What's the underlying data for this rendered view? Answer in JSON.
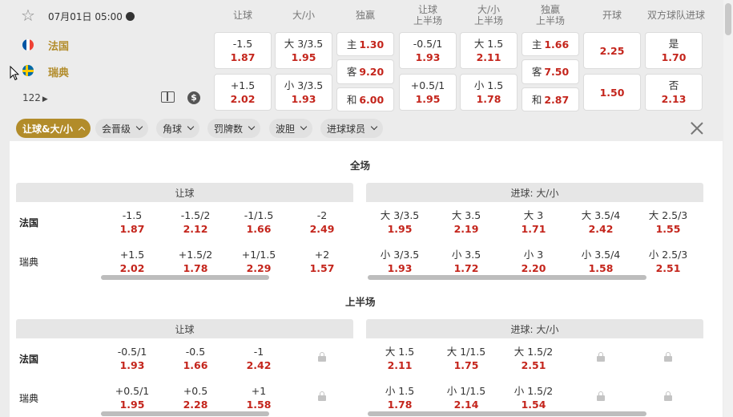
{
  "match": {
    "datetime": "07月01日 05:00",
    "home": "法国",
    "away": "瑞典",
    "more_count": "122"
  },
  "headers": [
    "让球",
    "大/小",
    "独赢",
    "让球\n上半场",
    "大/小\n上半场",
    "独赢\n上半场",
    "开球",
    "双方球队进球"
  ],
  "top_odds": {
    "handicap": [
      {
        "label": "-1.5",
        "odd": "1.87"
      },
      {
        "label": "+1.5",
        "odd": "2.02"
      }
    ],
    "ou": [
      {
        "label": "大 3/3.5",
        "odd": "1.95"
      },
      {
        "label": "小 3/3.5",
        "odd": "1.93"
      }
    ],
    "win": [
      {
        "label": "主",
        "odd": "1.30"
      },
      {
        "label": "客",
        "odd": "9.20"
      },
      {
        "label": "和",
        "odd": "6.00"
      }
    ],
    "handicap_h1": [
      {
        "label": "-0.5/1",
        "odd": "1.93"
      },
      {
        "label": "+0.5/1",
        "odd": "1.95"
      }
    ],
    "ou_h1": [
      {
        "label": "大 1.5",
        "odd": "2.11"
      },
      {
        "label": "小 1.5",
        "odd": "1.78"
      }
    ],
    "win_h1": [
      {
        "label": "主",
        "odd": "1.66"
      },
      {
        "label": "客",
        "odd": "7.50"
      },
      {
        "label": "和",
        "odd": "2.87"
      }
    ],
    "kickoff": [
      {
        "odd": "2.25"
      },
      {
        "odd": "1.50"
      }
    ],
    "btts": [
      {
        "label": "是",
        "odd": "1.70"
      },
      {
        "label": "否",
        "odd": "2.13"
      }
    ]
  },
  "filters": [
    {
      "label": "让球&大/小",
      "active": true
    },
    {
      "label": "会晋级"
    },
    {
      "label": "角球"
    },
    {
      "label": "罚牌数"
    },
    {
      "label": "波胆"
    },
    {
      "label": "进球球员"
    }
  ],
  "sections": [
    {
      "title": "全场",
      "left_title": "让球",
      "right_title": "进球: 大/小",
      "rows": [
        "法国",
        "瑞典"
      ],
      "left": [
        [
          {
            "l": "-1.5",
            "o": "1.87"
          },
          {
            "l": "-1.5/2",
            "o": "2.12"
          },
          {
            "l": "-1/1.5",
            "o": "1.66"
          },
          {
            "l": "-2",
            "o": "2.49"
          }
        ],
        [
          {
            "l": "+1.5",
            "o": "2.02"
          },
          {
            "l": "+1.5/2",
            "o": "1.78"
          },
          {
            "l": "+1/1.5",
            "o": "2.29"
          },
          {
            "l": "+2",
            "o": "1.57"
          }
        ]
      ],
      "right": [
        [
          {
            "l": "大 3/3.5",
            "o": "1.95"
          },
          {
            "l": "大 3.5",
            "o": "2.19"
          },
          {
            "l": "大 3",
            "o": "1.71"
          },
          {
            "l": "大 3.5/4",
            "o": "2.42"
          },
          {
            "l": "大 2.5/3",
            "o": "1.55"
          }
        ],
        [
          {
            "l": "小 3/3.5",
            "o": "1.93"
          },
          {
            "l": "小 3.5",
            "o": "1.72"
          },
          {
            "l": "小 3",
            "o": "2.20"
          },
          {
            "l": "小 3.5/4",
            "o": "1.58"
          },
          {
            "l": "小 2.5/3",
            "o": "2.51"
          }
        ]
      ]
    },
    {
      "title": "上半场",
      "left_title": "让球",
      "right_title": "进球: 大/小",
      "rows": [
        "法国",
        "瑞典"
      ],
      "left": [
        [
          {
            "l": "-0.5/1",
            "o": "1.93"
          },
          {
            "l": "-0.5",
            "o": "1.66"
          },
          {
            "l": "-1",
            "o": "2.42"
          },
          {
            "lock": true
          }
        ],
        [
          {
            "l": "+0.5/1",
            "o": "1.95"
          },
          {
            "l": "+0.5",
            "o": "2.28"
          },
          {
            "l": "+1",
            "o": "1.58"
          },
          {
            "lock": true
          }
        ]
      ],
      "right": [
        [
          {
            "l": "大 1.5",
            "o": "2.11"
          },
          {
            "l": "大 1/1.5",
            "o": "1.75"
          },
          {
            "l": "大 1.5/2",
            "o": "2.51"
          },
          {
            "lock": true
          },
          {
            "lock": true
          }
        ],
        [
          {
            "l": "小 1.5",
            "o": "1.78"
          },
          {
            "l": "小 1/1.5",
            "o": "2.14"
          },
          {
            "l": "小 1.5/2",
            "o": "1.54"
          },
          {
            "lock": true
          },
          {
            "lock": true
          }
        ]
      ]
    }
  ],
  "colors": {
    "accent": "#b28c2a",
    "odd": "#c4251c"
  }
}
